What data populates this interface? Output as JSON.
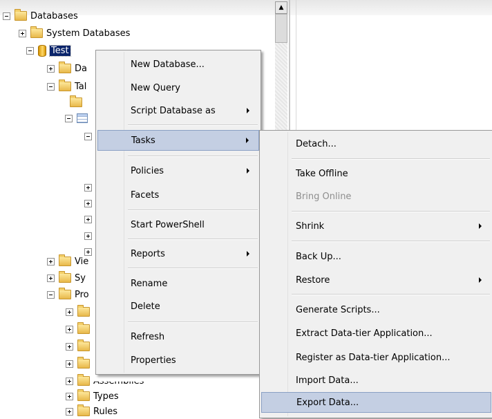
{
  "tree": {
    "nodes": [
      {
        "label": "Databases"
      },
      {
        "label": "System Databases"
      },
      {
        "label": "Test"
      },
      {
        "label": "Da"
      },
      {
        "label": "Tal"
      },
      {
        "label": "Vie"
      },
      {
        "label": "Sy"
      },
      {
        "label": "Pro"
      },
      {
        "label": "Assemblies"
      },
      {
        "label": "Types"
      },
      {
        "label": "Rules"
      }
    ]
  },
  "context_menu": {
    "items": [
      {
        "label": "New Database..."
      },
      {
        "label": "New Query"
      },
      {
        "label": "Script Database as"
      },
      {
        "label": "Tasks"
      },
      {
        "label": "Policies"
      },
      {
        "label": "Facets"
      },
      {
        "label": "Start PowerShell"
      },
      {
        "label": "Reports"
      },
      {
        "label": "Rename"
      },
      {
        "label": "Delete"
      },
      {
        "label": "Refresh"
      },
      {
        "label": "Properties"
      }
    ]
  },
  "tasks_submenu": {
    "items": [
      {
        "label": "Detach..."
      },
      {
        "label": "Take Offline"
      },
      {
        "label": "Bring Online"
      },
      {
        "label": "Shrink"
      },
      {
        "label": "Back Up..."
      },
      {
        "label": "Restore"
      },
      {
        "label": "Generate Scripts..."
      },
      {
        "label": "Extract Data-tier Application..."
      },
      {
        "label": "Register as Data-tier Application..."
      },
      {
        "label": "Import Data..."
      },
      {
        "label": "Export Data..."
      }
    ]
  },
  "colors": {
    "selection": "#0a246a",
    "menu_highlight": "#c4cfe3",
    "menu_background": "#f0f0f0",
    "disabled_text": "#8e8e8e"
  }
}
